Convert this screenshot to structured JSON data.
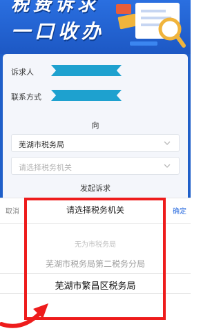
{
  "banner": {
    "line1": "税费诉求",
    "line2": "一口收办"
  },
  "form": {
    "petitioner_label": "诉求人",
    "contact_label": "联系方式",
    "to_label": "向",
    "bureau_value": "芜湖市税务局",
    "tax_office_placeholder": "请选择税务机关",
    "submit_label": "发起诉求"
  },
  "picker": {
    "cancel_label": "取消",
    "title": "请选择税务机关",
    "confirm_label": "确定",
    "options": [
      "无为市税务局",
      "芜湖市税务局第二税务分局",
      "芜湖市繁昌区税务局"
    ],
    "selected_index": 2
  },
  "colors": {
    "brand_blue": "#1f5fc9",
    "redaction": "#1ea1cf",
    "highlight": "#ee1c1c",
    "confirm": "#2f6fe0"
  },
  "icons": {
    "select_chevron": "chevron-down-icon",
    "banner_art": "magnifier-document-illustration",
    "annotation_arrow": "curved-arrow-annotation"
  }
}
